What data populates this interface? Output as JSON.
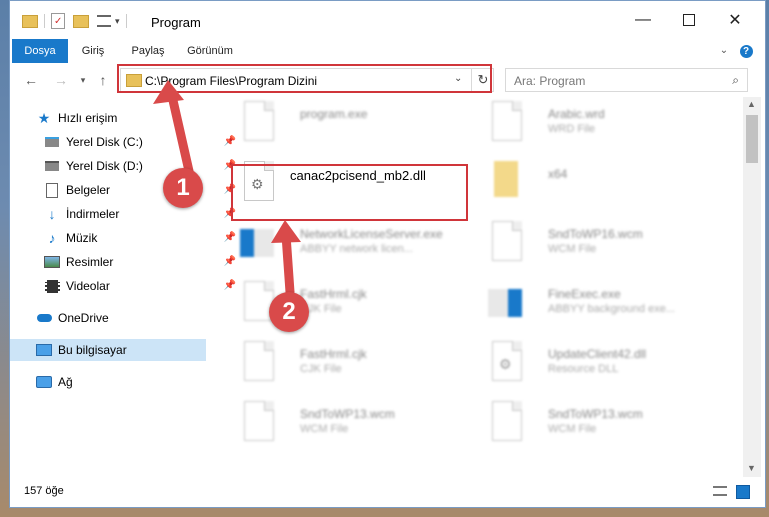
{
  "window": {
    "title": "Program"
  },
  "ribbon": {
    "tabs": [
      "Dosya",
      "Giriş",
      "Paylaş",
      "Görünüm"
    ]
  },
  "address": {
    "path": "C:\\Program Files\\Program Dizini",
    "search_placeholder": "Ara: Program"
  },
  "sidebar": {
    "items": [
      {
        "label": "Hızlı erişim",
        "icon": "star-icon"
      },
      {
        "label": "Yerel Disk (C:)",
        "icon": "drive-icon"
      },
      {
        "label": "Yerel Disk (D:)",
        "icon": "drive-icon"
      },
      {
        "label": "Belgeler",
        "icon": "documents-icon"
      },
      {
        "label": "İndirmeler",
        "icon": "download-icon"
      },
      {
        "label": "Müzik",
        "icon": "music-icon"
      },
      {
        "label": "Resimler",
        "icon": "pictures-icon"
      },
      {
        "label": "Videolar",
        "icon": "video-icon"
      },
      {
        "label": "OneDrive",
        "icon": "cloud-icon"
      },
      {
        "label": "Bu bilgisayar",
        "icon": "computer-icon"
      },
      {
        "label": "Ağ",
        "icon": "network-icon"
      }
    ]
  },
  "files": [
    {
      "name": "program.exe",
      "type": ""
    },
    {
      "name": "Arabic.wrd",
      "type": "WRD File"
    },
    {
      "name": "canac2pcisend_mb2.dll",
      "type": ""
    },
    {
      "name": "x64",
      "type": ""
    },
    {
      "name": "NetworkLicenseServer.exe",
      "type": "ABBYY network licen..."
    },
    {
      "name": "SndToWP16.wcm",
      "type": "WCM File"
    },
    {
      "name": "FastHrml.cjk",
      "type": "CJK File"
    },
    {
      "name": "FineExec.exe",
      "type": "ABBYY background exe..."
    },
    {
      "name": "FastHrml.cjk",
      "type": "CJK File"
    },
    {
      "name": "UpdateClient42.dll",
      "type": "Resource DLL"
    },
    {
      "name": "SndToWP13.wcm",
      "type": "WCM File"
    },
    {
      "name": "SndToWP13.wcm",
      "type": "WCM File"
    }
  ],
  "status": {
    "count": "157 öğe"
  },
  "annotations": {
    "step1": "1",
    "step2": "2"
  },
  "colors": {
    "accent": "#1979ca",
    "highlight": "#d0353a",
    "selected": "#cce4f7"
  }
}
